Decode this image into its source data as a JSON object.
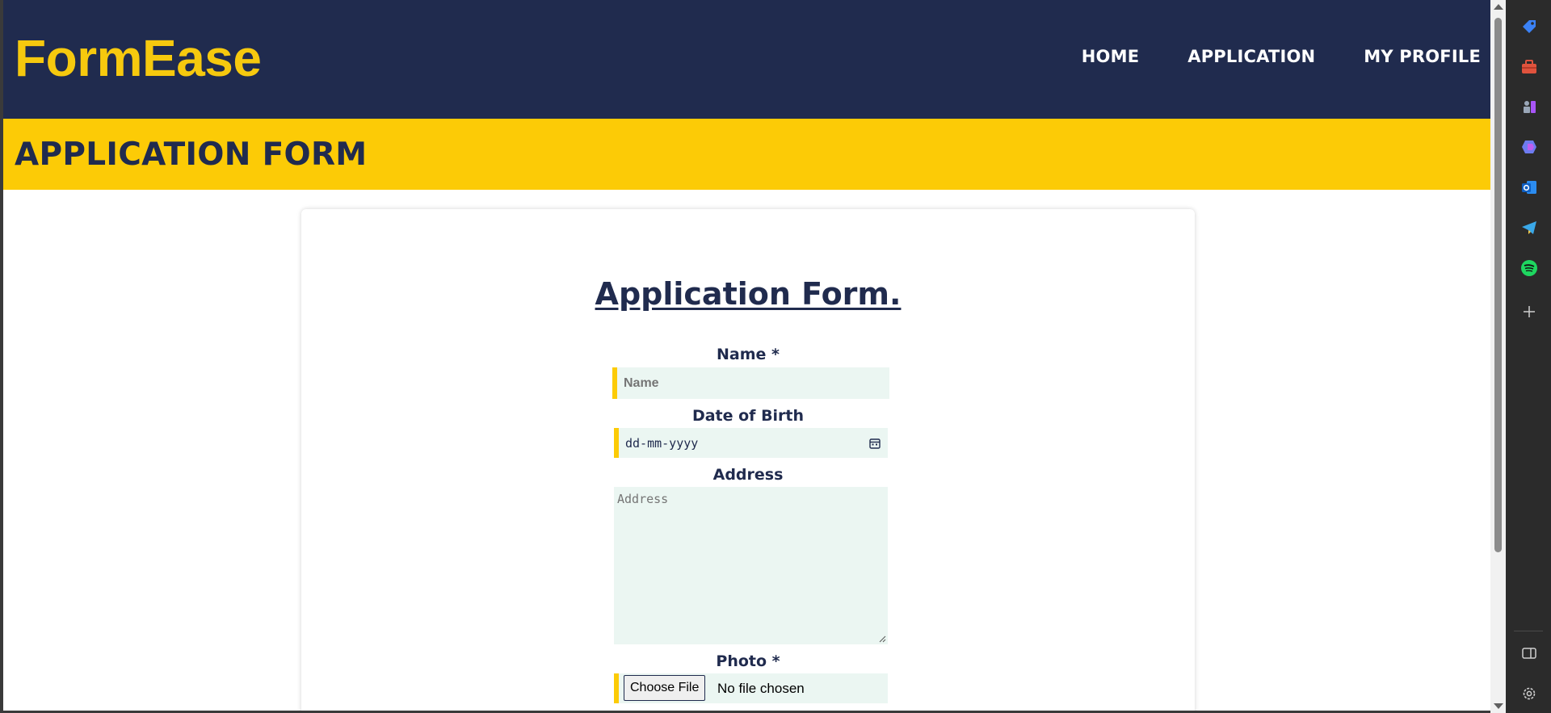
{
  "brand": {
    "logo_text": "FormEase"
  },
  "nav": {
    "items": [
      "HOME",
      "APPLICATION",
      "MY PROFILE"
    ]
  },
  "banner": {
    "title": "APPLICATION FORM"
  },
  "form": {
    "title": "Application Form.",
    "name_label": "Name *",
    "name_placeholder": "Name",
    "dob_label": "Date of Birth",
    "dob_placeholder": "dd-mm-yyyy",
    "address_label": "Address",
    "address_placeholder": "Address",
    "photo_label": "Photo *",
    "file_button": "Choose File",
    "file_status": "No file chosen"
  },
  "edge_sidebar": {
    "icons": [
      "tag-icon",
      "toolbox-icon",
      "chess-icon",
      "copilot-icon",
      "outlook-icon",
      "telegram-icon",
      "spotify-icon",
      "plus-icon",
      "split-screen-icon",
      "settings-icon"
    ]
  },
  "colors": {
    "navy": "#202b4e",
    "yellow": "#fccb06",
    "logo_yellow": "#f6c90e",
    "field_bg": "#ebf6f2"
  }
}
